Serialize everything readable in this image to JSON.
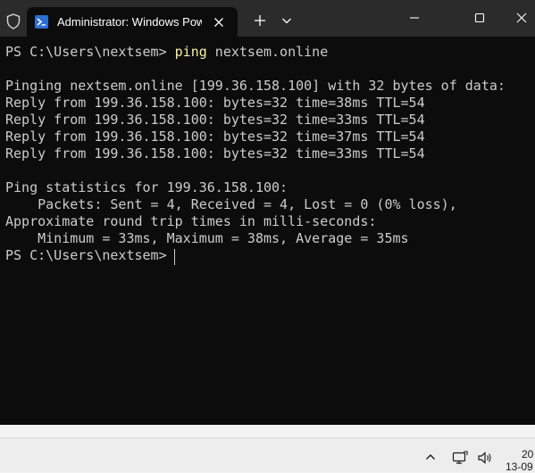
{
  "tab": {
    "title": "Administrator: Windows PowerShell",
    "icon": "powershell-icon"
  },
  "colors": {
    "terminal_bg": "#0c0c0c",
    "titlebar_bg": "#2b2b2b",
    "text": "#cccccc",
    "command_highlight": "#f9f1a5"
  },
  "terminal": {
    "prompt1": "PS C:\\Users\\nextsem> ",
    "cmd_name": "ping",
    "cmd_args": " nextsem.online",
    "lines": [
      "Pinging nextsem.online [199.36.158.100] with 32 bytes of data:",
      "Reply from 199.36.158.100: bytes=32 time=38ms TTL=54",
      "Reply from 199.36.158.100: bytes=32 time=33ms TTL=54",
      "Reply from 199.36.158.100: bytes=32 time=37ms TTL=54",
      "Reply from 199.36.158.100: bytes=32 time=33ms TTL=54",
      "Ping statistics for 199.36.158.100:",
      "    Packets: Sent = 4, Received = 4, Lost = 0 (0% loss),",
      "Approximate round trip times in milli-seconds:",
      "    Minimum = 33ms, Maximum = 38ms, Average = 35ms"
    ],
    "prompt2": "PS C:\\Users\\nextsem> "
  },
  "taskbar": {
    "time": "20",
    "date": "13-09",
    "icons": [
      "chevron-up-icon",
      "network-icon",
      "volume-icon"
    ]
  }
}
